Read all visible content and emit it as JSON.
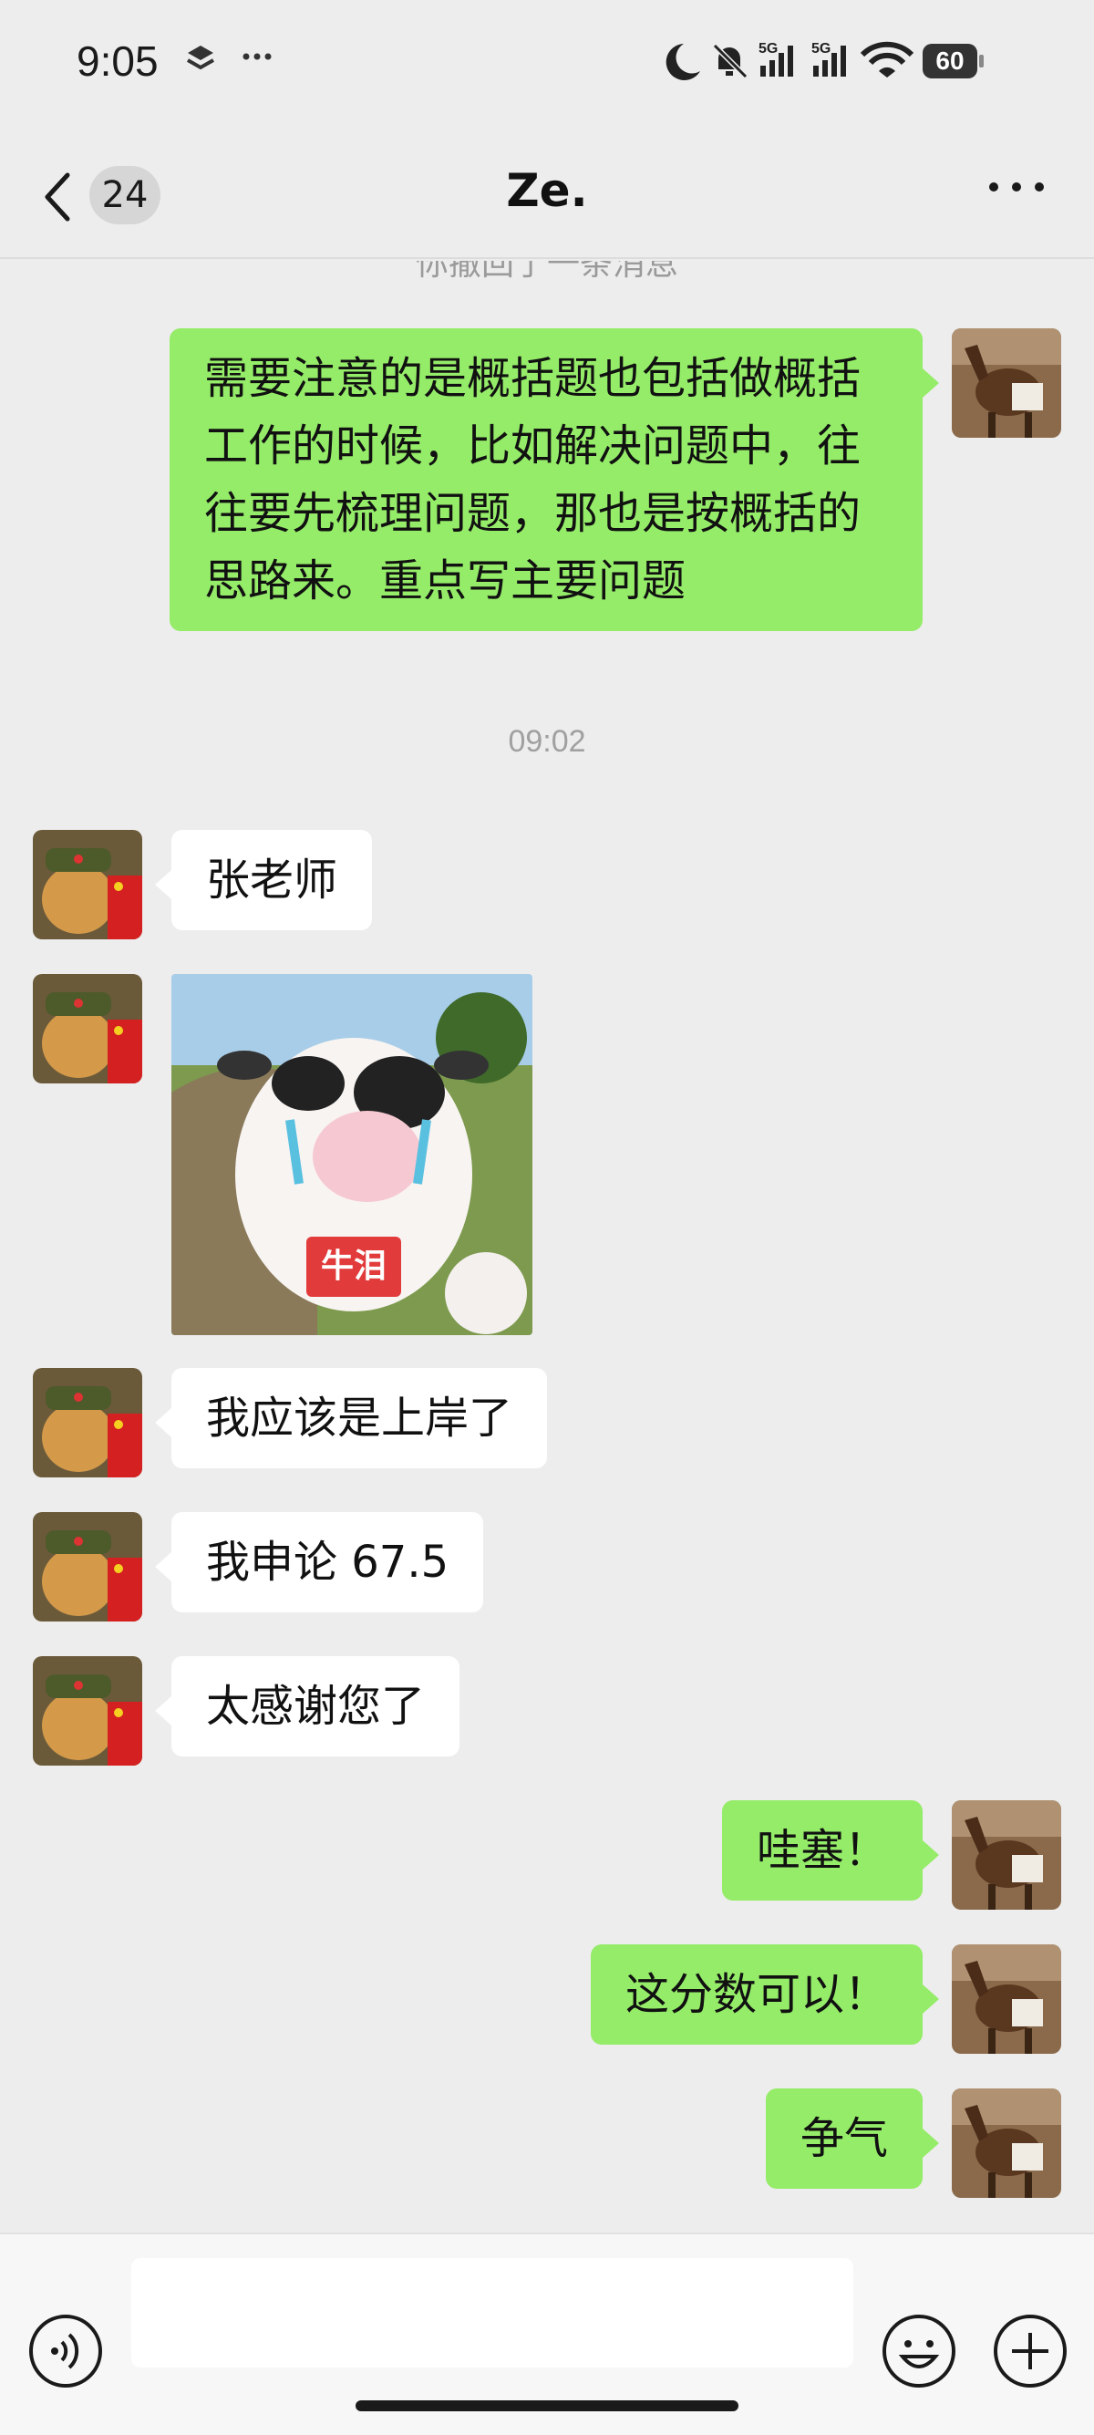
{
  "status_bar": {
    "time": "9:05",
    "extra": "···",
    "network_1": "5G",
    "network_2": "5G",
    "battery": "60"
  },
  "nav": {
    "unread_count": "24",
    "title": "Ze."
  },
  "chat": {
    "recall_note": "你撤回了一条消息",
    "time_label": "09:02",
    "messages": [
      {
        "side": "right",
        "text": "需要注意的是概括题也包括做概括工作的时候，比如解决问题中，往往要先梳理问题，那也是按概括的思路来。重点写主要问题"
      },
      {
        "side": "left",
        "text": "张老师"
      },
      {
        "side": "left",
        "type": "sticker",
        "label": "牛泪"
      },
      {
        "side": "left",
        "text": "我应该是上岸了"
      },
      {
        "side": "left",
        "text": "我申论 67.5"
      },
      {
        "side": "left",
        "text": "太感谢您了"
      },
      {
        "side": "right",
        "text": "哇塞！"
      },
      {
        "side": "right",
        "text": "这分数可以！"
      },
      {
        "side": "right",
        "text": "争气"
      }
    ]
  },
  "colors": {
    "background": "#ededed",
    "my_bubble": "#95ec69",
    "their_bubble": "#ffffff"
  },
  "input": {
    "value": "",
    "voice_icon": "voice-icon",
    "emoji_icon": "emoji-icon",
    "plus_icon": "plus-icon"
  }
}
